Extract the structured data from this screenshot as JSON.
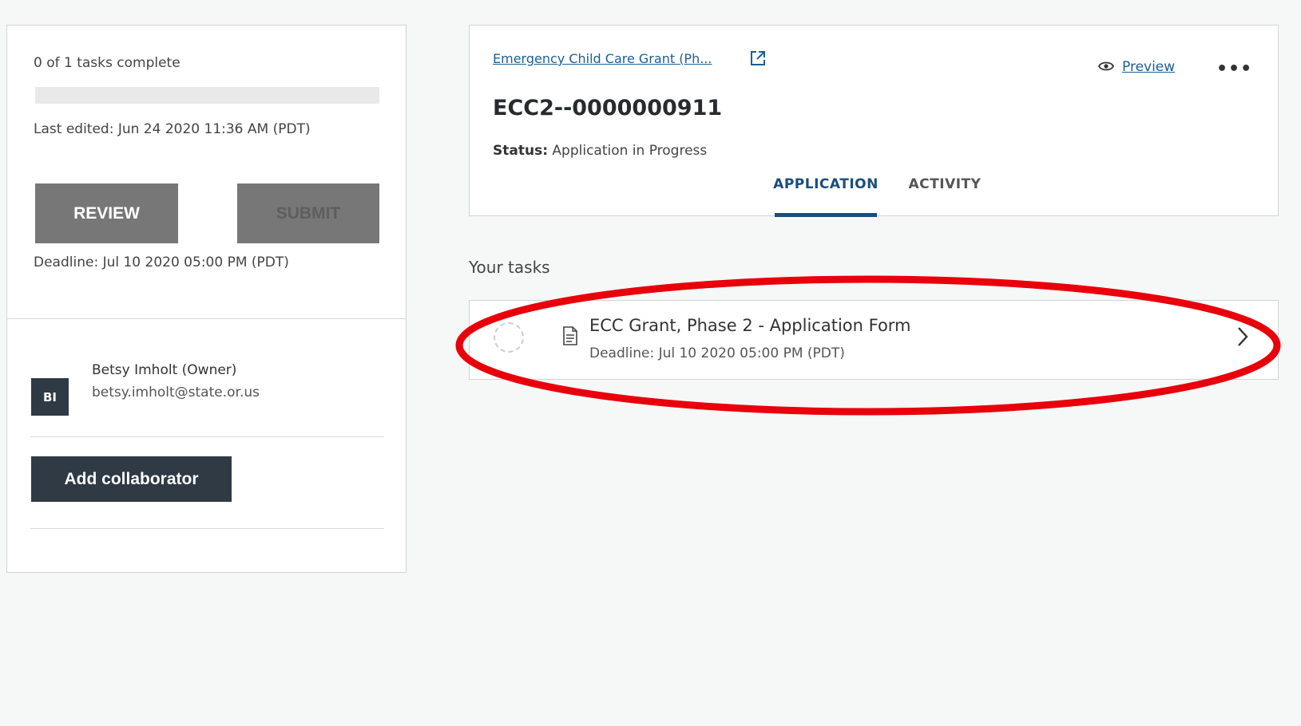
{
  "sidebar": {
    "tasks_complete": "0 of 1 tasks complete",
    "progress_fraction": 0,
    "last_edited": "Last edited: Jun 24 2020 11:36 AM (PDT)",
    "review_label": "REVIEW",
    "submit_label": "SUBMIT",
    "deadline": "Deadline: Jul 10 2020 05:00 PM (PDT)",
    "collaborator": {
      "initials": "BI",
      "name": "Betsy Imholt (Owner)",
      "email": "betsy.imholt@state.or.us"
    },
    "add_collaborator_label": "Add collaborator"
  },
  "header": {
    "program_link": "Emergency Child Care Grant (Ph...",
    "preview_label": "Preview",
    "more_label": "•••",
    "application_id": "ECC2--0000000911",
    "status_label": "Status:",
    "status_value": "Application in Progress",
    "tabs": [
      {
        "label": "APPLICATION",
        "active": true
      },
      {
        "label": "ACTIVITY",
        "active": false
      }
    ]
  },
  "tasks": {
    "heading": "Your tasks",
    "items": [
      {
        "title": "ECC Grant, Phase 2 - Application Form",
        "deadline": "Deadline: Jul 10 2020 05:00 PM (PDT)"
      }
    ]
  },
  "colors": {
    "accent": "#1a4d7c",
    "link": "#1d5e93",
    "dark_button": "#2f3a45",
    "gray_button": "#777777",
    "annotation": "#e8000b"
  }
}
